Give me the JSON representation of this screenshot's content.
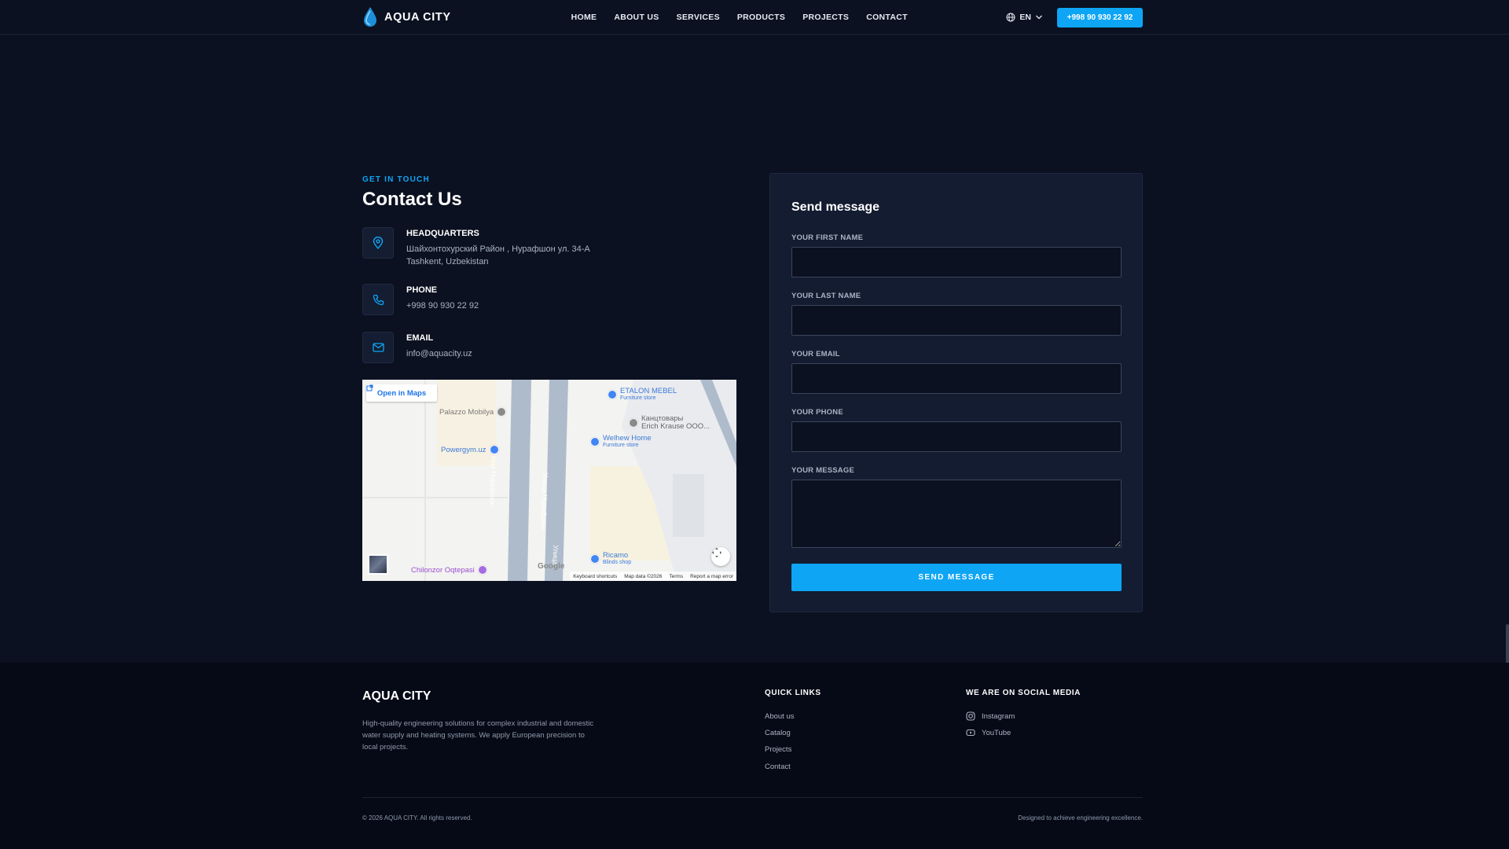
{
  "header": {
    "logo_text": "AQUA CITY",
    "nav": [
      "HOME",
      "ABOUT US",
      "SERVICES",
      "PRODUCTS",
      "PROJECTS",
      "CONTACT"
    ],
    "language": "EN",
    "phone_button": "+998 90 930 22 92"
  },
  "contact": {
    "eyebrow": "GET IN TOUCH",
    "title": "Contact Us",
    "headquarters": {
      "label": "HEADQUARTERS",
      "line1": "Шайхонтохурский Район , Нурафшон ул. 34-А",
      "line2": "Tashkent, Uzbekistan"
    },
    "phone": {
      "label": "PHONE",
      "value": "+998 90 930 22 92"
    },
    "email": {
      "label": "EMAIL",
      "value": "info@aquacity.uz"
    }
  },
  "map": {
    "open_label": "Open in Maps",
    "street_1": "Улица Нурафшон",
    "street_2": "Улица Нурафшон",
    "street_3": "Улица",
    "pois": {
      "palazzo": "Palazzo Mobilya",
      "powergym": "Powergym.uz",
      "etalon": "ETALON MEBEL",
      "etalon_sub": "Furniture store",
      "kanc": "Канцтовары",
      "kanc2": "Erich Krause OOO...",
      "welhew": "Welhew Home",
      "welhew_sub": "Furniture store",
      "ricamo": "Ricamo",
      "ricamo_sub": "Blinds shop",
      "chilonzor": "Chilonzor Oqtepasi"
    },
    "google": "Google",
    "footer": [
      "Keyboard shortcuts",
      "Map data ©2026",
      "Terms",
      "Report a map error"
    ]
  },
  "form": {
    "title": "Send message",
    "first_name_label": "YOUR FIRST NAME",
    "last_name_label": "YOUR LAST NAME",
    "email_label": "YOUR EMAIL",
    "phone_label": "YOUR PHONE",
    "message_label": "YOUR MESSAGE",
    "submit": "SEND MESSAGE"
  },
  "footer": {
    "brand": "AQUA CITY",
    "description": "High-quality engineering solutions for complex industrial and domestic water supply and heating systems. We apply European precision to local projects.",
    "quick_links_title": "QUICK LINKS",
    "quick_links": [
      "About us",
      "Catalog",
      "Projects",
      "Contact"
    ],
    "social_title": "WE ARE ON SOCIAL MEDIA",
    "social": [
      {
        "label": "Instagram",
        "icon": "instagram-icon"
      },
      {
        "label": "YouTube",
        "icon": "youtube-icon"
      }
    ],
    "copyright": "© 2026 AQUA CITY. All rights reserved.",
    "designed": "Designed to achieve engineering excellence."
  },
  "colors": {
    "background": "#0b1120",
    "card": "#131c30",
    "footer": "#060a16",
    "accent": "#0ea5f5"
  }
}
